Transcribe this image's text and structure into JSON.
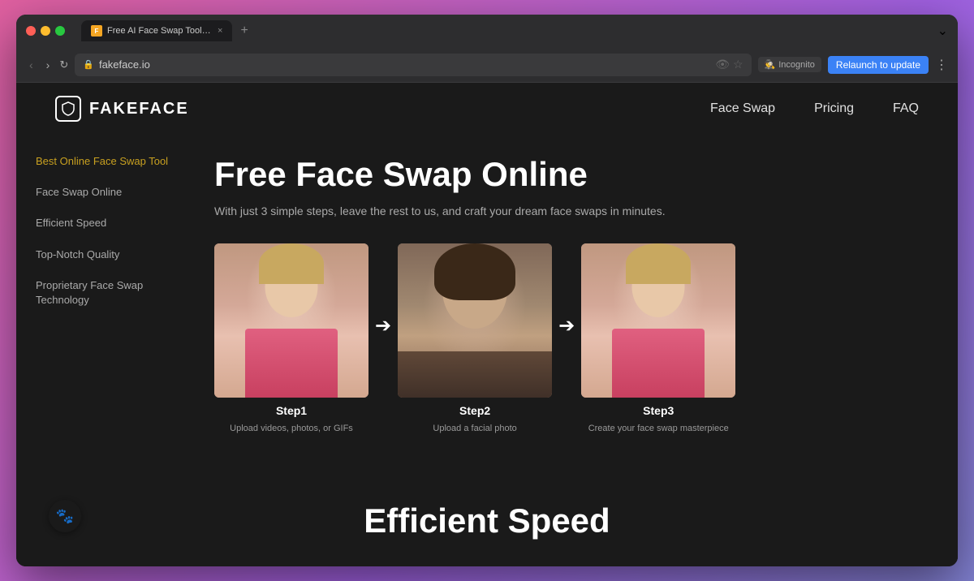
{
  "browser": {
    "tab_favicon": "F",
    "tab_title": "Free AI Face Swap Tool for V...",
    "tab_close": "×",
    "new_tab": "+",
    "back": "‹",
    "forward": "›",
    "refresh": "↻",
    "url": "fakeface.io",
    "url_icon": "🔒",
    "eye_icon": "👁",
    "star_icon": "☆",
    "incognito_text": "Incognito",
    "relaunch_label": "Relaunch to update",
    "more_dots": "⋮",
    "expand_icon": "⌄"
  },
  "nav": {
    "logo_text": "FAKEFACE",
    "logo_icon": "🛡",
    "links": [
      {
        "label": "Face Swap",
        "id": "face-swap"
      },
      {
        "label": "Pricing",
        "id": "pricing"
      },
      {
        "label": "FAQ",
        "id": "faq"
      }
    ]
  },
  "sidebar": {
    "items": [
      {
        "label": "Best Online Face Swap Tool",
        "active": true
      },
      {
        "label": "Face Swap Online",
        "active": false
      },
      {
        "label": "Efficient Speed",
        "active": false
      },
      {
        "label": "Top-Notch Quality",
        "active": false
      },
      {
        "label": "Proprietary Face Swap Technology",
        "active": false
      }
    ]
  },
  "hero": {
    "title": "Free Face Swap Online",
    "subtitle": "With just 3 simple steps, leave the rest to us, and craft your dream face swaps in minutes."
  },
  "steps": [
    {
      "id": "step1",
      "label": "Step1",
      "description": "Upload videos, photos, or GIFs"
    },
    {
      "id": "step2",
      "label": "Step2",
      "description": "Upload a facial photo"
    },
    {
      "id": "step3",
      "label": "Step3",
      "description": "Create your face swap masterpiece"
    }
  ],
  "arrow": "➔",
  "bottom": {
    "title": "Efficient Speed"
  },
  "chat_btn": "🐾"
}
